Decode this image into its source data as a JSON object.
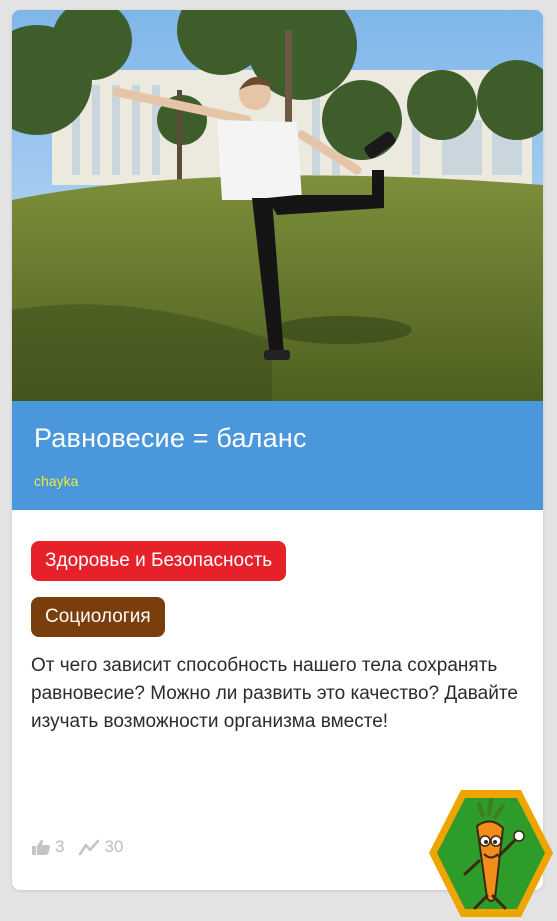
{
  "card": {
    "image_alt": "girl balancing on one leg on a grassy lawn",
    "title": "Равновесие = баланс",
    "author": "chayka",
    "tags": [
      {
        "label": "Здоровье и Безопасность",
        "color": "#e62129"
      },
      {
        "label": "Социология",
        "color": "#7a3d0c"
      }
    ],
    "description": "От чего зависит способность нашего тела сохранять равновесие? Можно ли развить это качество? Давайте изучать возможности организма вместе!",
    "stats": {
      "likes": "3",
      "views": "30",
      "like_icon": "thumbs-up-icon",
      "views_icon": "trend-icon"
    }
  },
  "badge": {
    "icon": "carrot-mascot-icon",
    "colors": {
      "outer": "#f0a400",
      "inner": "#2e9c2a"
    }
  },
  "colors": {
    "title_band": "#4a97db",
    "author": "#f2ea37",
    "background": "#e3e3e3"
  }
}
